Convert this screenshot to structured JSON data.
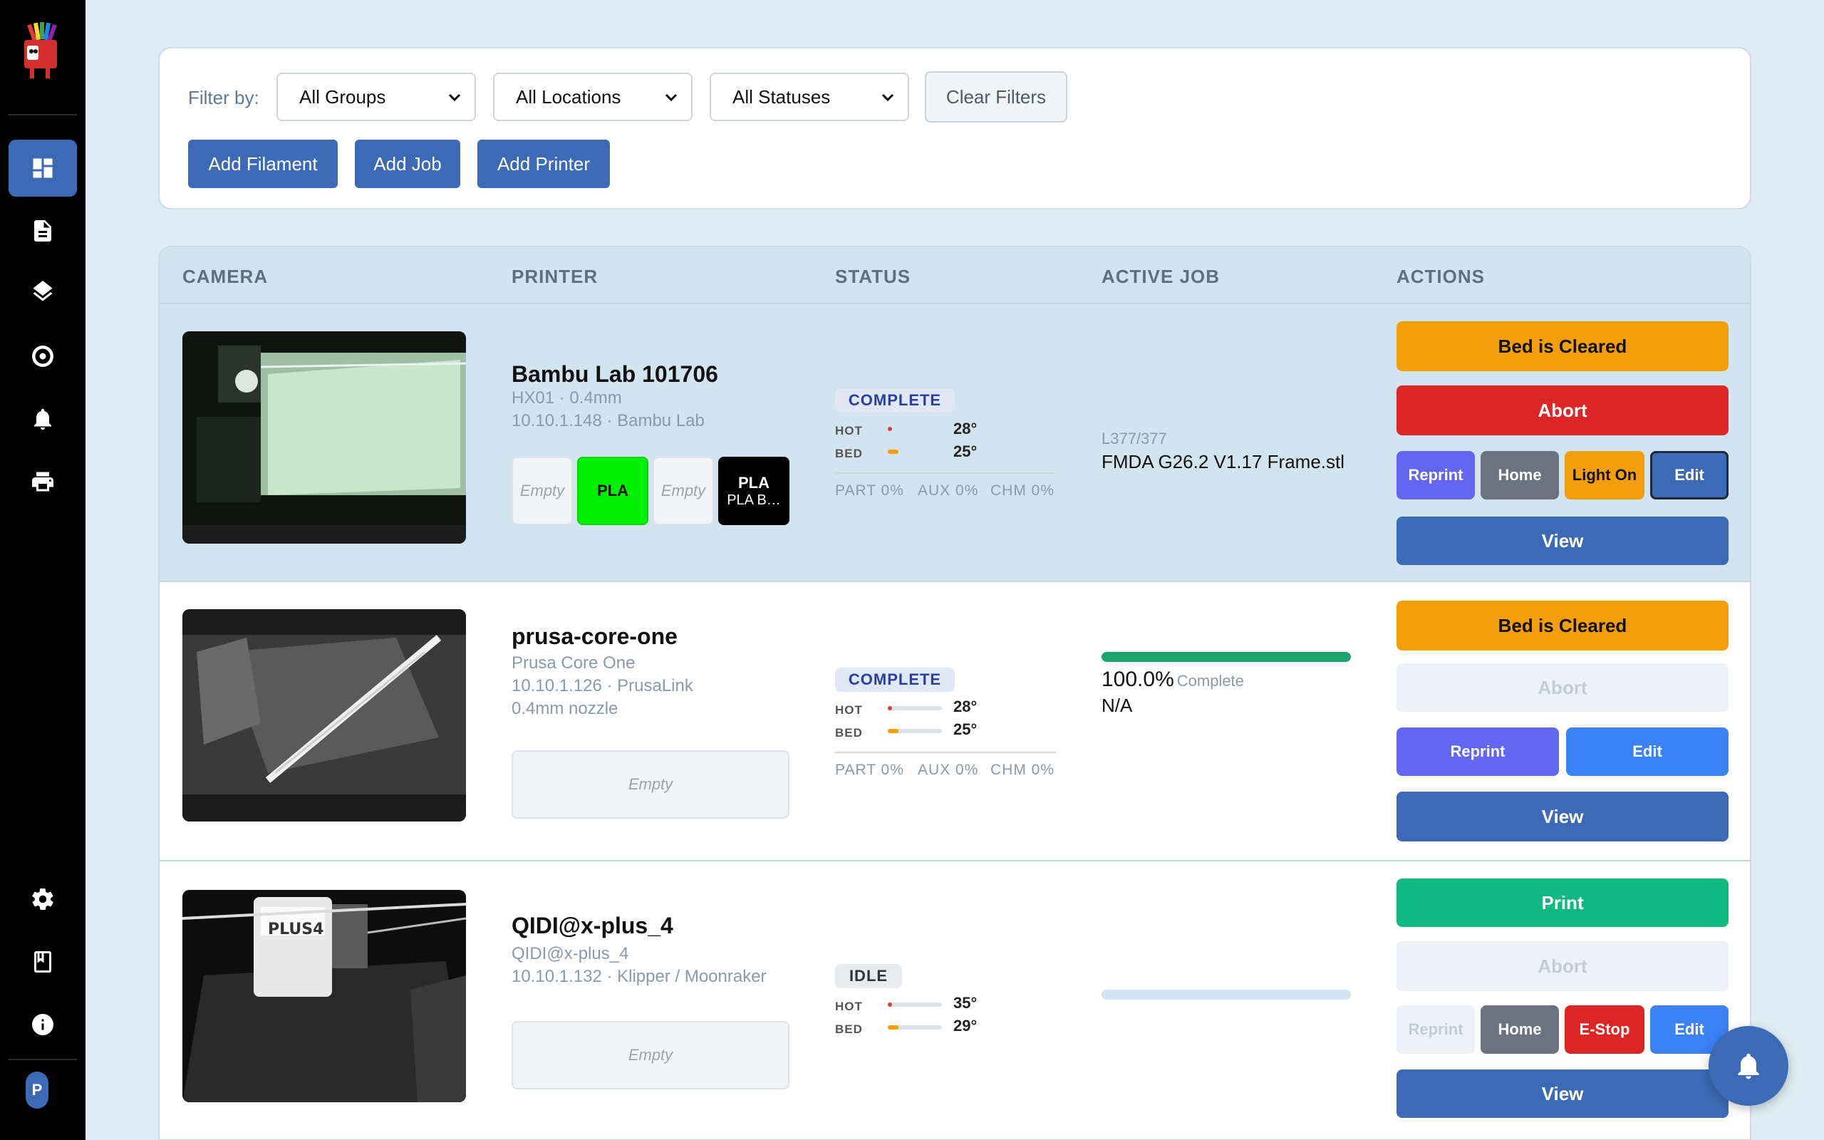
{
  "sidebar": {
    "items": [
      {
        "name": "dashboard-icon",
        "active": true
      },
      {
        "name": "document-icon"
      },
      {
        "name": "layers-icon"
      },
      {
        "name": "target-icon"
      },
      {
        "name": "bell-icon"
      },
      {
        "name": "printer-icon"
      },
      {
        "name": "gear-icon"
      },
      {
        "name": "book-icon"
      },
      {
        "name": "info-icon"
      }
    ],
    "avatar": "P"
  },
  "filters": {
    "label": "Filter by:",
    "groups": "All Groups",
    "locations": "All Locations",
    "statuses": "All Statuses",
    "clear": "Clear Filters"
  },
  "toolbar": {
    "add_filament": "Add Filament",
    "add_job": "Add Job",
    "add_printer": "Add Printer"
  },
  "table": {
    "headers": [
      "CAMERA",
      "PRINTER",
      "STATUS",
      "ACTIVE JOB",
      "ACTIONS"
    ]
  },
  "printers": [
    {
      "name": "Bambu Lab 101706",
      "sub1": "HX01 · 0.4mm",
      "sub2": "10.10.1.148 · Bambu Lab",
      "spools": [
        {
          "label": "Empty"
        },
        {
          "label": "PLA",
          "color": "#00f000"
        },
        {
          "label": "Empty"
        },
        {
          "label": "PLA",
          "sub": "PLA B…",
          "color": "#000000"
        }
      ],
      "status": "COMPLETE",
      "hot_label": "HOT",
      "hot": "28°",
      "hot_pct": 0.08,
      "bed_label": "BED",
      "bed": "25°",
      "bed_pct": 0.2,
      "fans": {
        "part": "PART",
        "part_val": "0%",
        "aux": "AUX",
        "aux_val": "0%",
        "chm": "CHM",
        "chm_val": "0%"
      },
      "job_sub": "L377/377",
      "job_name": "FMDA G26.2 V1.17 Frame.stl",
      "actions": {
        "bed_cleared": "Bed is Cleared",
        "abort": "Abort",
        "reprint": "Reprint",
        "home": "Home",
        "light": "Light On",
        "edit": "Edit",
        "view": "View"
      }
    },
    {
      "name": "prusa-core-one",
      "sub1": "Prusa Core One",
      "sub2": "10.10.1.126 · PrusaLink",
      "sub3": "0.4mm nozzle",
      "spools": [
        {
          "label": "Empty"
        }
      ],
      "status": "COMPLETE",
      "hot_label": "HOT",
      "hot": "28°",
      "hot_pct": 0.08,
      "bed_label": "BED",
      "bed": "25°",
      "bed_pct": 0.2,
      "fans": {
        "part": "PART",
        "part_val": "0%",
        "aux": "AUX",
        "aux_val": "0%",
        "chm": "CHM",
        "chm_val": "0%"
      },
      "progress": 1.0,
      "progress_pct": "100.0%",
      "progress_label": "Complete",
      "job_name": "N/A",
      "actions": {
        "bed_cleared": "Bed is Cleared",
        "abort": "Abort",
        "reprint": "Reprint",
        "edit": "Edit",
        "view": "View"
      }
    },
    {
      "name": "QIDI@x-plus_4",
      "sub1": "QIDI@x-plus_4",
      "sub2": "10.10.1.132 · Klipper / Moonraker",
      "spools": [
        {
          "label": "Empty"
        }
      ],
      "status": "IDLE",
      "hot_label": "HOT",
      "hot": "35°",
      "hot_pct": 0.08,
      "bed_label": "BED",
      "bed": "29°",
      "bed_pct": 0.2,
      "progress": 0,
      "actions": {
        "print": "Print",
        "abort": "Abort",
        "reprint": "Reprint",
        "home": "Home",
        "estop": "E-Stop",
        "edit": "Edit",
        "view": "View"
      }
    }
  ]
}
